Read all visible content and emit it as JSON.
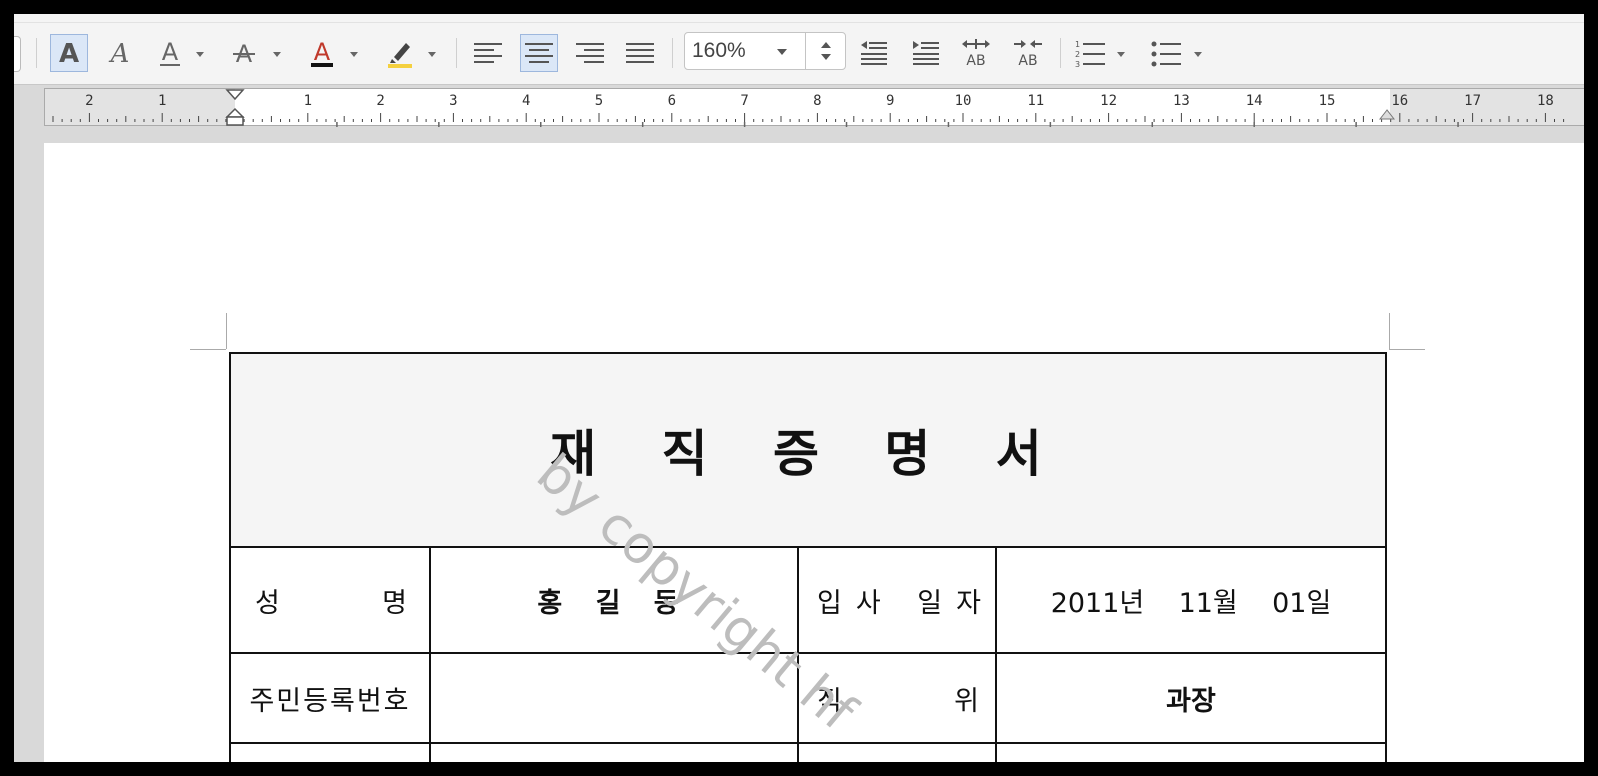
{
  "toolbar": {
    "zoom_value": "160%",
    "icons": [
      "bold-icon",
      "italic-icon",
      "underline-icon",
      "strikethrough-icon",
      "font-color-icon",
      "highlight-icon",
      "align-left-icon",
      "align-center-icon",
      "align-right-icon",
      "align-justify-icon",
      "outdent-icon",
      "indent-icon",
      "expand-spacing-icon",
      "condense-spacing-icon",
      "numbered-list-icon",
      "bullet-list-icon"
    ],
    "font_color": "#c0392b",
    "highlight_color": "#f4d03f"
  },
  "ruler": {
    "numbers": [
      "2",
      "1",
      "1",
      "2",
      "3",
      "4",
      "5",
      "6",
      "7",
      "8",
      "9",
      "10",
      "11",
      "12",
      "13",
      "14",
      "15",
      "16",
      "17",
      "18"
    ]
  },
  "document": {
    "watermark": "by copyright hf",
    "title": "재 직 증 명 서",
    "rows": [
      {
        "label1": "성 명",
        "value1": "홍 길 동",
        "label2": "입 사 일 자",
        "value2": "2011년    11월    01일"
      },
      {
        "label1": "주민등록번호",
        "value1": "",
        "label2": "직 위",
        "value2": "과장"
      }
    ]
  }
}
